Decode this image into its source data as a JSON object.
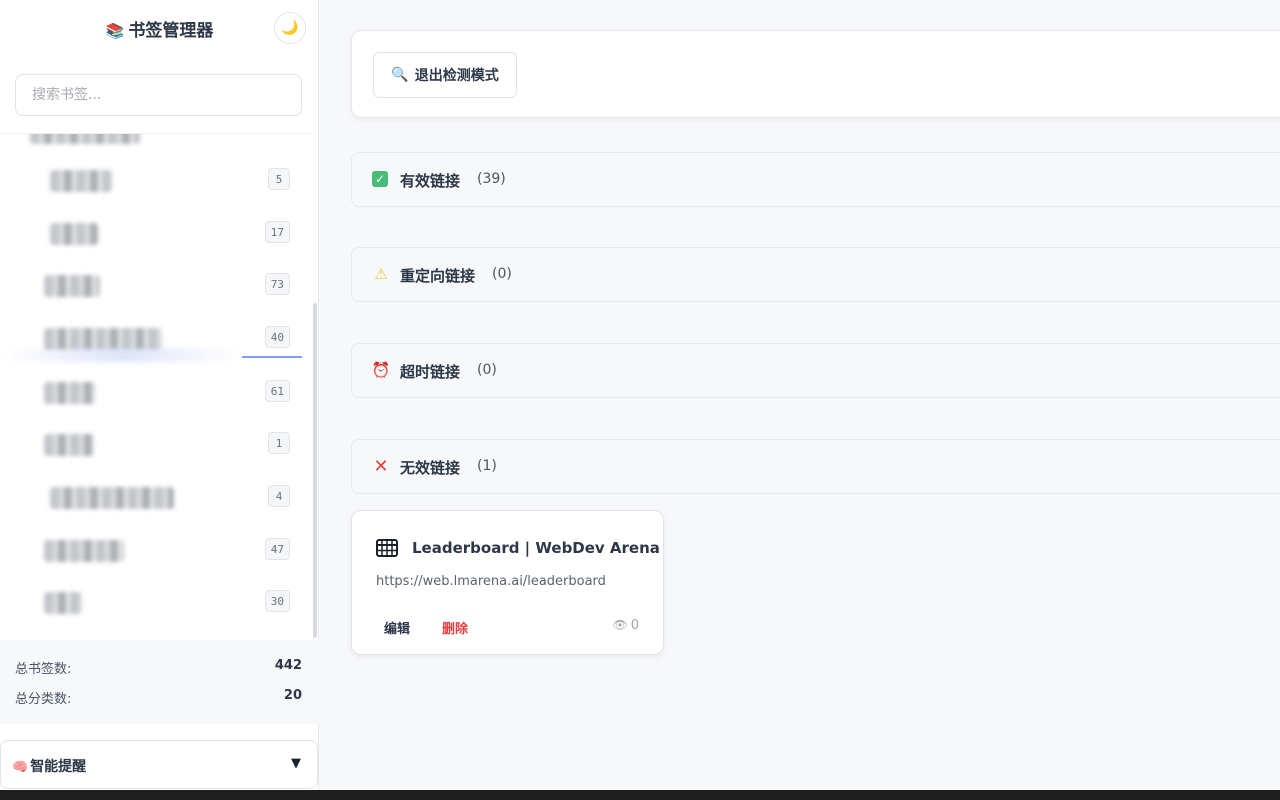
{
  "app": {
    "title": "书签管理器",
    "title_icon": "books-icon",
    "theme_toggle_icon": "moon-icon"
  },
  "search": {
    "placeholder": "搜索书签..."
  },
  "categories": [
    {
      "count": "5"
    },
    {
      "count": "17"
    },
    {
      "count": "73"
    },
    {
      "count": "40",
      "active": true
    },
    {
      "count": "61"
    },
    {
      "count": "1"
    },
    {
      "count": "4"
    },
    {
      "count": "47"
    },
    {
      "count": "30"
    }
  ],
  "stats": {
    "total_bookmarks_label": "总书签数:",
    "total_bookmarks_value": "442",
    "total_categories_label": "总分类数:",
    "total_categories_value": "20"
  },
  "reminder": {
    "icon": "brain-icon",
    "title": "智能提醒",
    "caret": "▼"
  },
  "toolbar": {
    "exit_detect_label": "退出检测模式",
    "exit_detect_icon": "magnifier-icon"
  },
  "sections": [
    {
      "key": "valid",
      "icon": "check-icon",
      "title": "有效链接",
      "count": "(39)",
      "color": "#48bb78"
    },
    {
      "key": "redirect",
      "icon": "warning-icon",
      "title": "重定向链接",
      "count": "(0)",
      "color": "#ecc94b"
    },
    {
      "key": "timeout",
      "icon": "alarm-clock-icon",
      "title": "超时链接",
      "count": "(0)",
      "color": "#e53e3e"
    },
    {
      "key": "invalid",
      "icon": "cross-icon",
      "title": "无效链接",
      "count": "(1)",
      "color": "#e53e3e"
    }
  ],
  "bookmark": {
    "icon": "grid-table-icon",
    "title": "Leaderboard | WebDev Arena",
    "url": "https://web.lmarena.ai/leaderboard",
    "edit_label": "编辑",
    "delete_label": "删除",
    "views_icon": "eye-icon",
    "views": "0"
  }
}
